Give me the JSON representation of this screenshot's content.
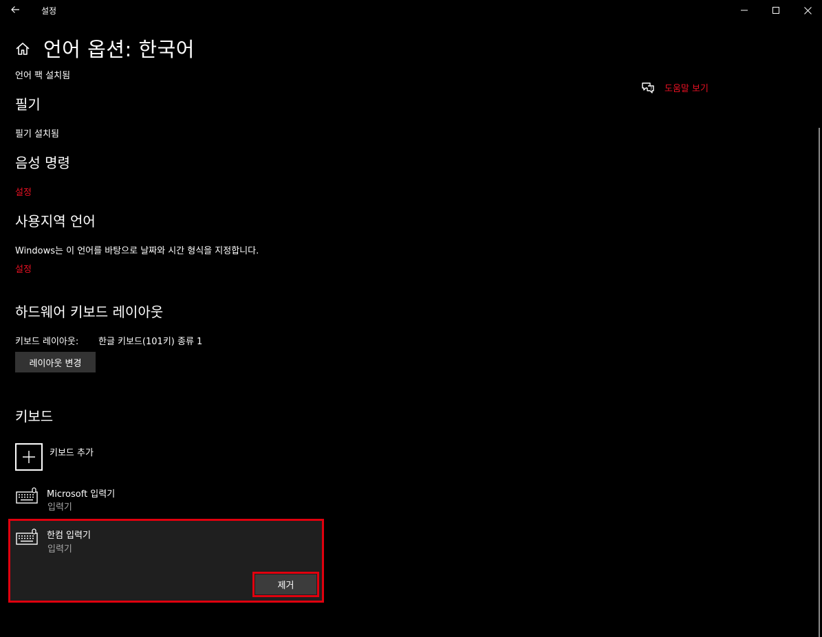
{
  "window": {
    "title": "설정",
    "back_icon": "back-arrow-icon",
    "minimize_icon": "minimize-icon",
    "maximize_icon": "maximize-icon",
    "close_icon": "close-icon"
  },
  "header": {
    "home_icon": "home-icon",
    "title": "언어 옵션: 한국어",
    "subtitle": "언어 팩 설치됨"
  },
  "help": {
    "icon": "help-chat-icon",
    "label": "도움말 보기"
  },
  "handwriting": {
    "heading": "필기",
    "status": "필기 설치됨"
  },
  "speech": {
    "heading": "음성 명령",
    "settings_link": "설정"
  },
  "regional": {
    "heading": "사용지역 언어",
    "description": "Windows는 이 언어를 바탕으로 날짜와 시간 형식을 지정합니다.",
    "settings_link": "설정"
  },
  "hardware_keyboard": {
    "heading": "하드웨어 키보드 레이아웃",
    "layout_label": "키보드 레이아웃:",
    "layout_value": "한글 키보드(101키) 종류 1",
    "change_button": "레이아웃 변경"
  },
  "keyboards": {
    "heading": "키보드",
    "add_label": "키보드 추가",
    "add_icon": "plus-icon",
    "items": [
      {
        "name": "Microsoft 입력기",
        "type": "입력기",
        "icon": "keyboard-icon"
      },
      {
        "name": "한컴 입력기",
        "type": "입력기",
        "icon": "keyboard-icon",
        "selected": true
      }
    ],
    "remove_button": "제거"
  },
  "colors": {
    "accent": "#e81123",
    "highlight": "#e0000e",
    "background": "#000000",
    "panel": "#1f1f1f",
    "button": "#333333"
  }
}
